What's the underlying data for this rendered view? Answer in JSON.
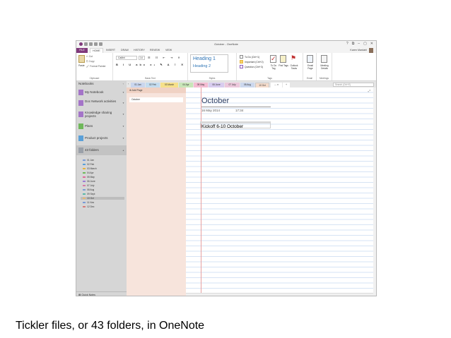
{
  "window": {
    "title": "October - OneNote",
    "controls": [
      "?",
      "⧉",
      "–",
      "▢",
      "✕"
    ]
  },
  "ribbon": {
    "tabs": [
      "FILE",
      "HOME",
      "INSERT",
      "DRAW",
      "HISTORY",
      "REVIEW",
      "VIEW"
    ],
    "active_tab": "HOME",
    "user_name": "Karen Mardahl",
    "clipboard": {
      "paste": "Paste",
      "cut": "Cut",
      "copy": "Copy",
      "format_painter": "Format Painter",
      "label": "Clipboard"
    },
    "basic_text": {
      "font": "Calibri",
      "size": "14",
      "label": "Basic Text"
    },
    "styles": {
      "heading1": "Heading 1",
      "heading2": "Heading 2",
      "label": "Styles"
    },
    "tags": {
      "todo": "To Do (Ctrl+1)",
      "important": "Important (Ctrl+2)",
      "question": "Question (Ctrl+3)",
      "todo_tag": "To Do Tag",
      "find_tags": "Find Tags",
      "outlook_tasks": "Outlook Tasks",
      "label": "Tags"
    },
    "email": {
      "email_page": "Email Page",
      "label": "Email"
    },
    "meetings": {
      "meeting_details": "Meeting Details",
      "label": "Meetings"
    }
  },
  "notebooks": {
    "header": "Notebooks",
    "items": [
      {
        "name": "My Notebook",
        "color": "#a474c8"
      },
      {
        "name": "Doc Network activities",
        "color": "#a474c8"
      },
      {
        "name": "Knowledge sharing projects",
        "color": "#a474c8"
      },
      {
        "name": "Plans",
        "color": "#6fb85a"
      },
      {
        "name": "Product projects",
        "color": "#5aa0d8"
      },
      {
        "name": "43 folders",
        "color": "#9aa0a8"
      }
    ],
    "sections": [
      {
        "name": "01 Jan",
        "color": "#7a9bd6"
      },
      {
        "name": "02 Feb",
        "color": "#5aa0d8"
      },
      {
        "name": "03 March",
        "color": "#e8b33c"
      },
      {
        "name": "04 Apr",
        "color": "#6fb85a"
      },
      {
        "name": "05 May",
        "color": "#e06a9a"
      },
      {
        "name": "06 June",
        "color": "#9a7ad6"
      },
      {
        "name": "07 July",
        "color": "#d67aa8"
      },
      {
        "name": "08 Aug",
        "color": "#7a9bd6"
      },
      {
        "name": "09 Sept",
        "color": "#5ab8a8"
      },
      {
        "name": "10 Oct",
        "color": "#e8b870"
      },
      {
        "name": "11 Nov",
        "color": "#7a9bd6"
      },
      {
        "name": "12 Dec",
        "color": "#d67a7a"
      }
    ],
    "quick_notes": "Quick Notes"
  },
  "section_tabs": [
    {
      "name": "01 Jan",
      "color": "#c9d6ee"
    },
    {
      "name": "02 Feb",
      "color": "#c4dcef"
    },
    {
      "name": "03 March",
      "color": "#f6e08a"
    },
    {
      "name": "04 Apr",
      "color": "#c8e6b8"
    },
    {
      "name": "05 May",
      "color": "#f4bcd2"
    },
    {
      "name": "06 June",
      "color": "#d8ccef"
    },
    {
      "name": "07 July",
      "color": "#ecc8dc"
    },
    {
      "name": "08 Aug",
      "color": "#ccd8ee"
    },
    {
      "name": "10 Oct",
      "color": "#f5dccc"
    }
  ],
  "search_placeholder": "Search (Ctrl+E)",
  "pages": {
    "add_page": "Add Page",
    "items": [
      "October"
    ]
  },
  "page": {
    "title": "October",
    "date": "16 May 2014",
    "time": "17:34",
    "note": "Kickoff 6-10 October"
  },
  "caption": "Tickler files, or 43 folders, in OneNote",
  "colors": {
    "brand": "#80397b",
    "page_panel": "#f7e4dc",
    "margin_line": "#e8a0a0"
  }
}
